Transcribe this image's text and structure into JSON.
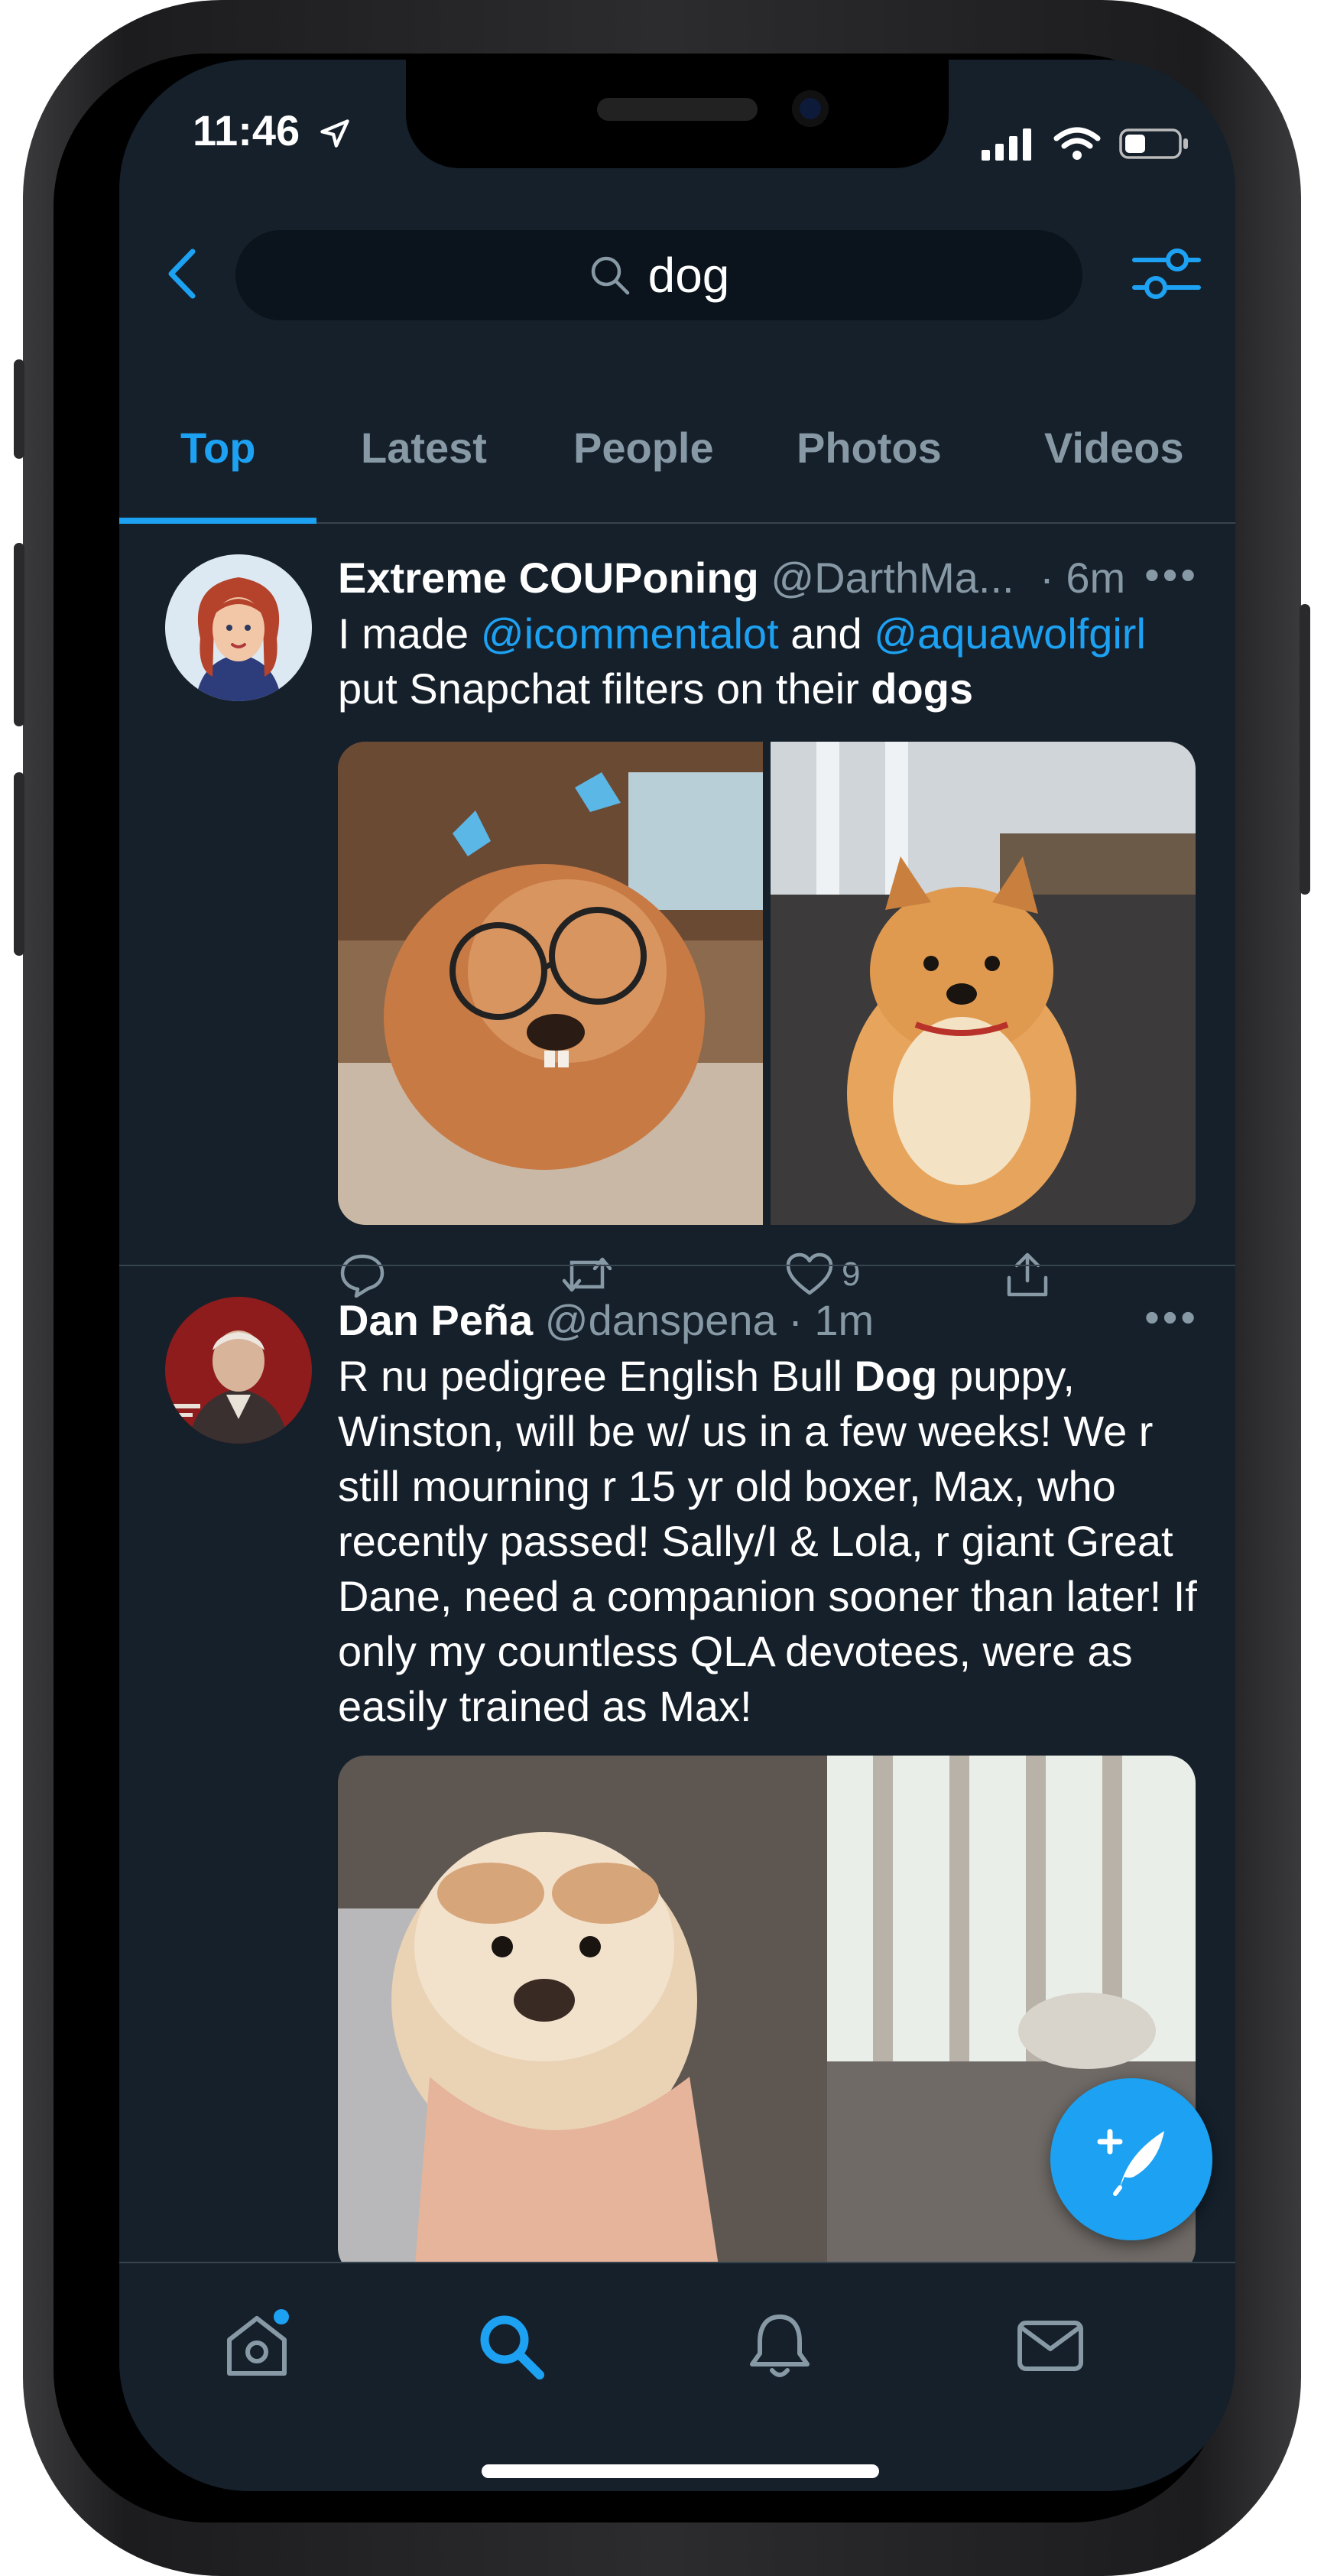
{
  "status_bar": {
    "time": "11:46"
  },
  "search": {
    "query": "dog"
  },
  "tabs": [
    {
      "label": "Top",
      "active": true
    },
    {
      "label": "Latest",
      "active": false
    },
    {
      "label": "People",
      "active": false
    },
    {
      "label": "Photos",
      "active": false
    },
    {
      "label": "Videos",
      "active": false
    }
  ],
  "tweets": [
    {
      "display_name": "Extreme COUPoning",
      "handle": "@DarthMa...",
      "time": "· 6m",
      "more": "•••",
      "body_parts": {
        "p1": "I made ",
        "mention1": "@icommentalot",
        "p2": " and ",
        "mention2": "@aquawolfgirl",
        "p3": "put Snapchat filters on their ",
        "bold": "dogs"
      },
      "like_count": "9"
    },
    {
      "display_name": "Dan Peña",
      "handle": "@danspena",
      "time": "· 1m",
      "more": "•••",
      "body_parts": {
        "p1": "R nu pedigree English Bull ",
        "bold": "Dog",
        "p2": " puppy, Winston, will be w/ us in a few weeks! We r still mourning r 15 yr old boxer, Max, who recently passed! Sally/I & Lola, r giant Great Dane, need a companion sooner than later! If only my countless QLA devotees, were as easily trained as Max!"
      }
    }
  ],
  "bottom_nav": [
    "home-icon",
    "search-icon",
    "notifications-icon",
    "messages-icon"
  ],
  "colors": {
    "background": "#15202b",
    "accent": "#1da1f2",
    "secondary_text": "#8899a6",
    "divider": "#38444d"
  }
}
